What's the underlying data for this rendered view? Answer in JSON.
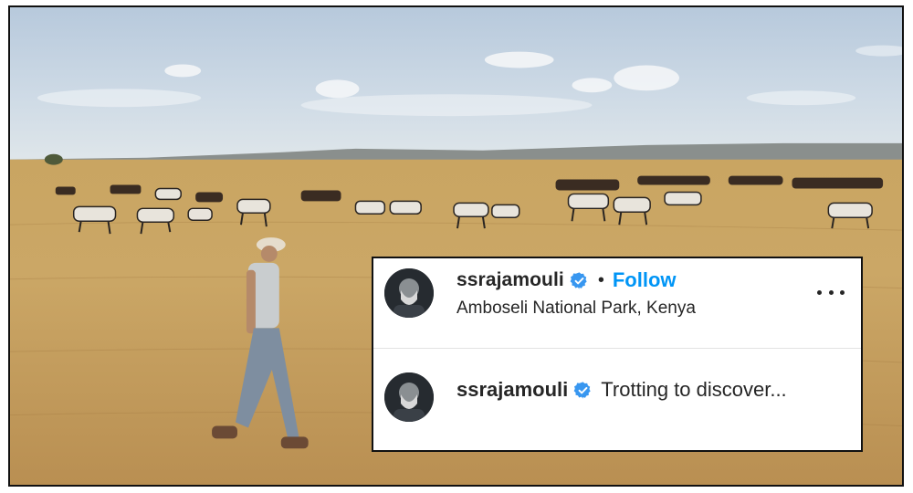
{
  "post": {
    "username": "ssrajamouli",
    "separator": "•",
    "follow_label": "Follow",
    "location": "Amboseli National Park, Kenya",
    "caption_username": "ssrajamouli",
    "caption_text": "Trotting to discover..."
  },
  "colors": {
    "follow_blue": "#0095f6",
    "verified_blue": "#3897f0",
    "text": "#262626"
  },
  "icons": {
    "verified": "verified-badge-icon",
    "more": "more-options-icon"
  }
}
